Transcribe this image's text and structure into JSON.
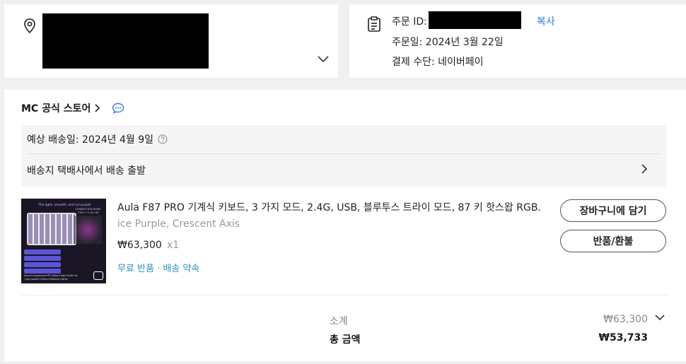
{
  "order": {
    "id_label": "주문 ID:",
    "copy_label": "복사",
    "date_text": "주문일: 2024년 3월 22일",
    "payment_text": "결제 수단: 네이버페이"
  },
  "store": {
    "name": "MC 공식 스토어"
  },
  "shipping": {
    "estimate_text": "예상 배송일: 2024년 4월 9일",
    "status_text": "배송지 택배사에서 배송 출발"
  },
  "product": {
    "title": "Aula F87 PRO 기계식 키보드, 3 가지 모드, 2.4G, USB, 블루투스 트라이 모드, 87 키 핫스왑 RGB...",
    "variant": "ice Purple, Crescent Axis",
    "price": "₩63,300",
    "quantity": "x1",
    "tags": "무료 반품 · 배송 약속",
    "thumb_lines": [
      "The light, smooth, and ice purple",
      "CONNECTION MODE",
      "TYPE-C+2.4G+BT",
      "Sound suppression:PE cotton+Ipex Shaft cot",
      "+pot gasket+Silicon+Bottom cotton"
    ]
  },
  "actions": {
    "add_to_cart": "장바구니에 담기",
    "return_refund": "반품/환불"
  },
  "summary": {
    "subtotal_label": "소계",
    "subtotal_value": "₩63,300",
    "total_label": "총 금액",
    "total_value": "₩53,733"
  },
  "colors": {
    "link": "#2c7be5",
    "tag": "#2c8fbd",
    "background": "#f0f0f0"
  }
}
